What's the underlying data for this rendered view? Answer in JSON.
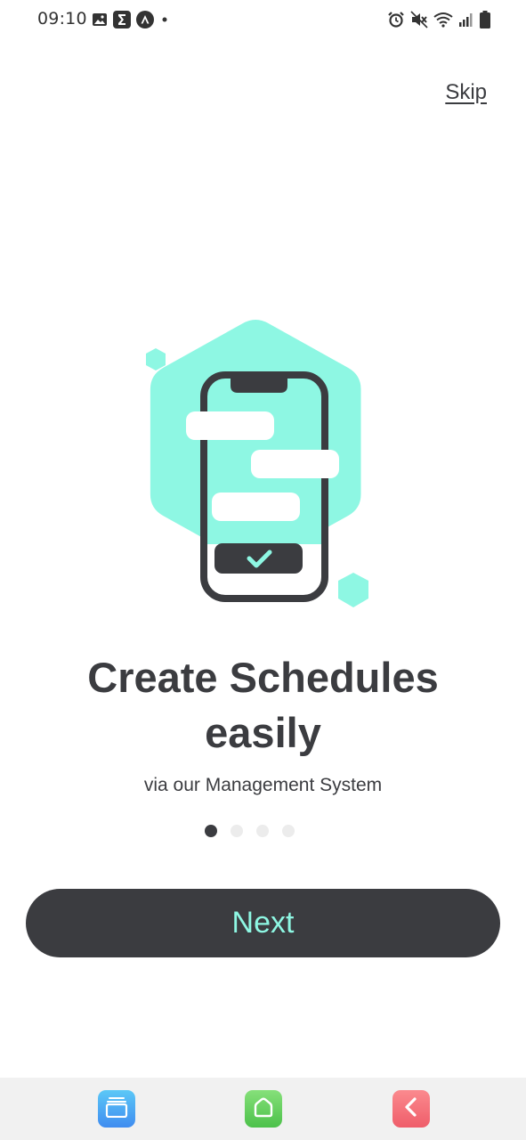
{
  "status_bar": {
    "time": "09:10",
    "left_icons": [
      "image-icon",
      "sigma-icon",
      "lambda-icon",
      "dot-icon"
    ],
    "right_icons": [
      "alarm-icon",
      "mute-icon",
      "wifi-icon",
      "signal-icon",
      "battery-icon"
    ]
  },
  "header": {
    "skip_label": "Skip"
  },
  "onboarding": {
    "title_line1": "Create Schedules",
    "title_line2": "easily",
    "subtitle": "via our Management System",
    "page_count": 4,
    "current_page": 1,
    "next_label": "Next"
  },
  "colors": {
    "accent": "#8ef7e3",
    "dark": "#3b3c40",
    "dot_inactive": "#ececec"
  },
  "bottom_nav": {
    "items": [
      "recent-apps-icon",
      "home-icon",
      "back-icon"
    ]
  }
}
